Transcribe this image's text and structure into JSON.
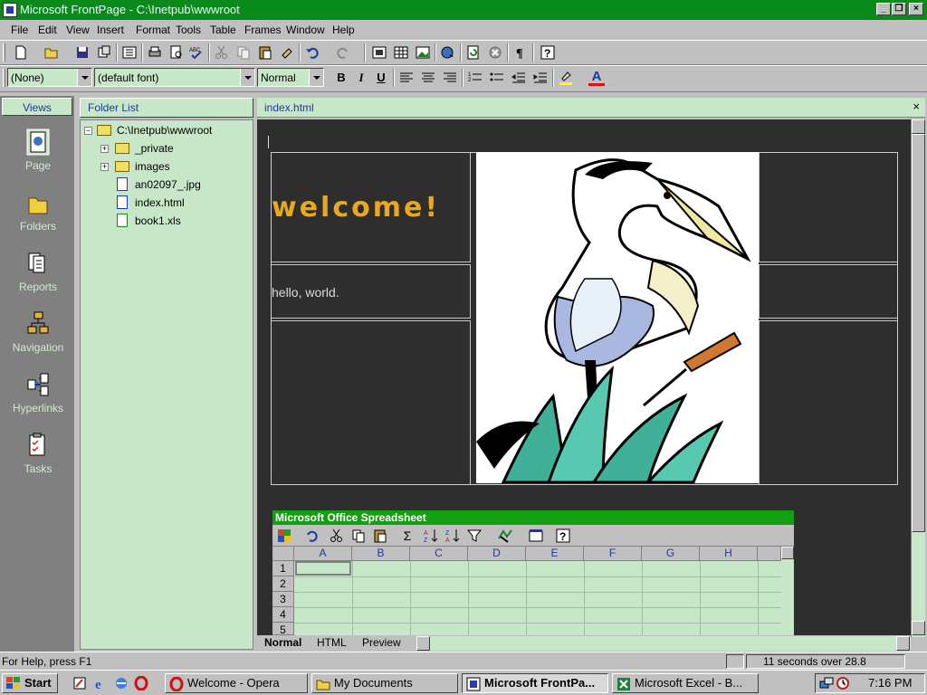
{
  "window": {
    "title": "Microsoft FrontPage - C:\\Inetpub\\wwwroot",
    "controls": [
      "minimize",
      "maximize",
      "close"
    ]
  },
  "menu": [
    "File",
    "Edit",
    "View",
    "Insert",
    "Format",
    "Tools",
    "Table",
    "Frames",
    "Window",
    "Help"
  ],
  "format_bar": {
    "style_value": "(None)",
    "font_value": "(default font)",
    "size_value": "Normal",
    "bold": "B",
    "italic": "I",
    "underline": "U",
    "font_color_label": "A"
  },
  "views": {
    "header": "Views",
    "items": [
      {
        "label": "Page",
        "icon": "page-view-icon",
        "selected": true
      },
      {
        "label": "Folders",
        "icon": "folders-view-icon"
      },
      {
        "label": "Reports",
        "icon": "reports-view-icon"
      },
      {
        "label": "Navigation",
        "icon": "navigation-view-icon"
      },
      {
        "label": "Hyperlinks",
        "icon": "hyperlinks-view-icon"
      },
      {
        "label": "Tasks",
        "icon": "tasks-view-icon"
      }
    ]
  },
  "folder_list": {
    "header": "Folder List",
    "root": "C:\\Inetpub\\wwwroot",
    "items": [
      "_private",
      "images",
      "an02097_.jpg",
      "index.html",
      "book1.xls"
    ]
  },
  "editor": {
    "tab_name": "index.html",
    "close_glyph": "×",
    "welcome_text": "welcome!",
    "hello_text": "hello, world.",
    "welcome_color": "#e8a820"
  },
  "spreadsheet": {
    "title": "Microsoft Office Spreadsheet",
    "columns": [
      "A",
      "B",
      "C",
      "D",
      "E",
      "F",
      "G",
      "H"
    ],
    "rows": [
      "1",
      "2",
      "3",
      "4",
      "5"
    ],
    "sigma": "Σ"
  },
  "view_tabs": [
    "Normal",
    "HTML",
    "Preview"
  ],
  "status": {
    "help_text": "For Help, press F1",
    "download_time": "11 seconds over 28.8"
  },
  "taskbar": {
    "start_label": "Start",
    "tasks": [
      "Welcome - Opera",
      "My Documents",
      "Microsoft FrontPa...",
      "Microsoft Excel - B..."
    ],
    "clock": "7:16 PM"
  },
  "colors": {
    "titlebar": "#0a8a1a",
    "panel_header": "#c8e6c8",
    "canvas_bg": "#2e2e2e",
    "spreadsheet_title": "#12a012"
  }
}
